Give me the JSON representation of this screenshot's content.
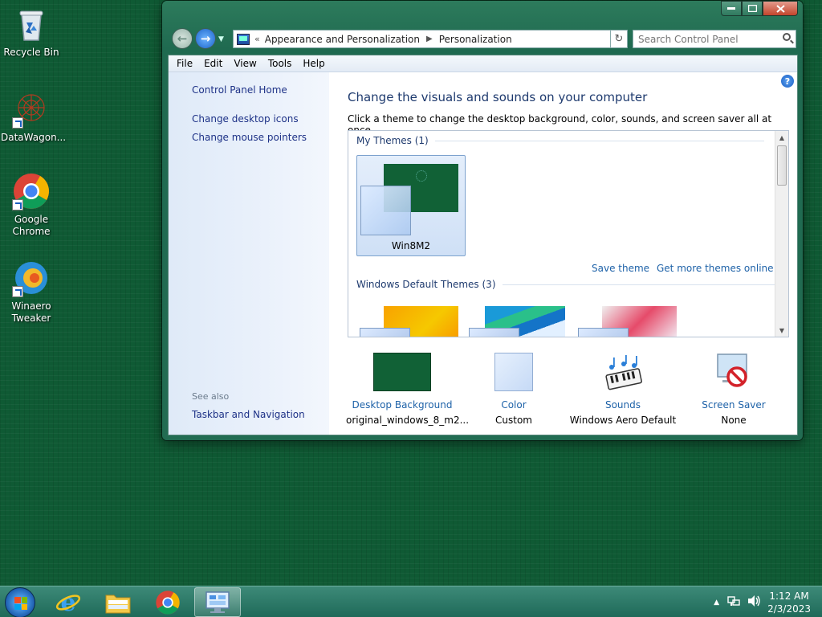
{
  "desktop": {
    "icons": [
      {
        "label": "Recycle Bin"
      },
      {
        "label": "DataWagon..."
      },
      {
        "label": "Google Chrome"
      },
      {
        "label": "Winaero Tweaker"
      }
    ]
  },
  "window": {
    "breadcrumb": {
      "items": [
        "Appearance and Personalization",
        "Personalization"
      ]
    },
    "search": {
      "placeholder": "Search Control Panel"
    },
    "menu": [
      "File",
      "Edit",
      "View",
      "Tools",
      "Help"
    ],
    "sidebar": {
      "home": "Control Panel Home",
      "links": [
        "Change desktop icons",
        "Change mouse pointers"
      ],
      "see_also_label": "See also",
      "see_also_links": [
        "Taskbar and Navigation"
      ]
    },
    "main": {
      "title": "Change the visuals and sounds on your computer",
      "subtitle": "Click a theme to change the desktop background, color, sounds, and screen saver all at once.",
      "my_themes": {
        "label": "My Themes (1)",
        "items": [
          {
            "name": "Win8M2"
          }
        ]
      },
      "save_theme": "Save theme",
      "get_more": "Get more themes online",
      "default_themes": {
        "label": "Windows Default Themes (3)"
      }
    },
    "bottom": [
      {
        "link": "Desktop Background",
        "value": "original_windows_8_m2..."
      },
      {
        "link": "Color",
        "value": "Custom"
      },
      {
        "link": "Sounds",
        "value": "Windows Aero Default"
      },
      {
        "link": "Screen Saver",
        "value": "None"
      }
    ]
  },
  "taskbar": {
    "clock": {
      "time": "1:12 AM",
      "date": "2/3/2023"
    }
  },
  "colors": {
    "desktop": "#0f5a34",
    "link": "#1e62a8",
    "title": "#1e3a6e"
  }
}
